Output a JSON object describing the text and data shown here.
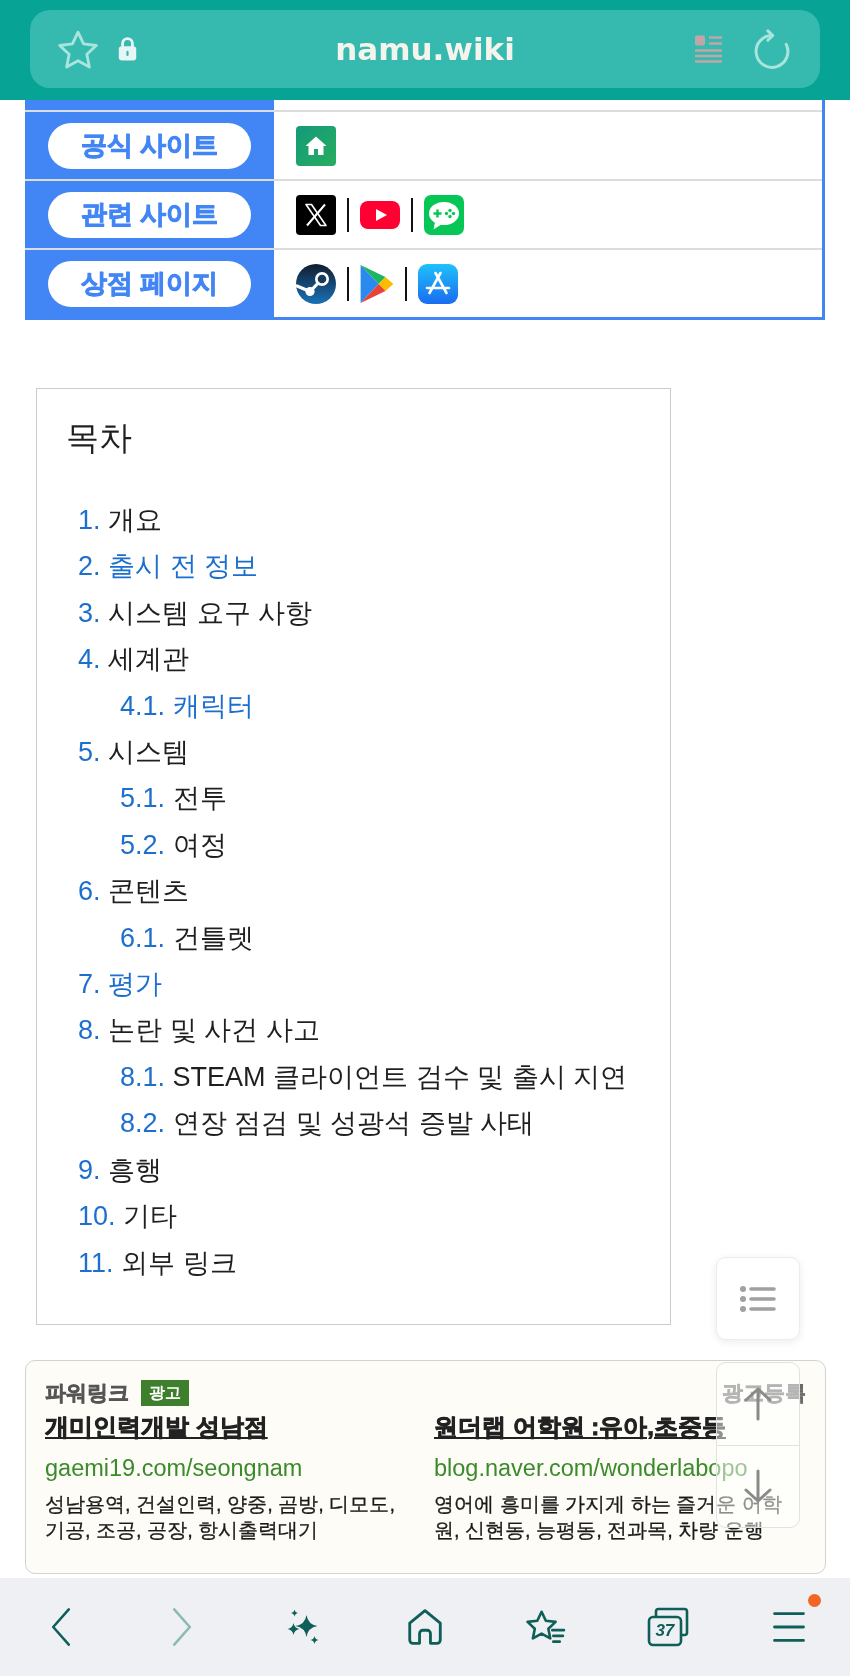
{
  "browser_bar": {
    "address": "namu.wiki"
  },
  "info_table": {
    "rows": [
      {
        "label": "공식 사이트",
        "links": [
          {
            "kind": "home"
          }
        ]
      },
      {
        "label": "관련 사이트",
        "links": [
          {
            "kind": "x"
          },
          {
            "kind": "video"
          },
          {
            "kind": "chat"
          }
        ]
      },
      {
        "label": "상점 페이지",
        "links": [
          {
            "kind": "steam"
          },
          {
            "kind": "play"
          },
          {
            "kind": "store"
          }
        ]
      }
    ]
  },
  "toc": {
    "title": "목차",
    "items": [
      {
        "number": "1.",
        "title": "개요",
        "linked": false
      },
      {
        "number": "2.",
        "title": "출시 전 정보",
        "linked": true
      },
      {
        "number": "3.",
        "title": "시스템 요구 사항",
        "linked": false
      },
      {
        "number": "4.",
        "title": "세계관",
        "linked": false,
        "children": [
          {
            "number": "4.1.",
            "title": "캐릭터",
            "linked": true
          }
        ]
      },
      {
        "number": "5.",
        "title": "시스템",
        "linked": false,
        "children": [
          {
            "number": "5.1.",
            "title": "전투",
            "linked": false
          },
          {
            "number": "5.2.",
            "title": "여정",
            "linked": false
          }
        ]
      },
      {
        "number": "6.",
        "title": "콘텐츠",
        "linked": false,
        "children": [
          {
            "number": "6.1.",
            "title": "건틀렛",
            "linked": false
          }
        ]
      },
      {
        "number": "7.",
        "title": "평가",
        "linked": true
      },
      {
        "number": "8.",
        "title": "논란 및 사건 사고",
        "linked": false,
        "children": [
          {
            "number": "8.1.",
            "title": "STEAM 클라이언트 검수 및 출시 지연",
            "linked": false
          },
          {
            "number": "8.2.",
            "title": "연장 점검 및 성광석 증발 사태",
            "linked": false
          }
        ]
      },
      {
        "number": "9.",
        "title": "흥행",
        "linked": false
      },
      {
        "number": "10.",
        "title": "기타",
        "linked": false
      },
      {
        "number": "11.",
        "title": "외부 링크",
        "linked": false
      }
    ]
  },
  "powerlink": {
    "title": "파워링크",
    "badge": "광고",
    "register_link": "광고등록",
    "ads": [
      {
        "title": "개미인력개발 성남점",
        "url": "gaemi19.com/seongnam",
        "description": "성남용역, 건설인력, 양중, 곰방, 디모도, 기공, 조공, 공장, 항시출력대기"
      },
      {
        "title": "원더랩 어학원 :유아,초중등",
        "url": "blog.naver.com/wonderlabopo",
        "description": "영어에 흥미를 가지게 하는 즐거운 어학원, 신현동, 능평동, 전과목, 차량 운행"
      }
    ]
  },
  "bottom_toolbar": {
    "items": [
      {
        "kind": "back",
        "disabled": false
      },
      {
        "kind": "forward",
        "disabled": true
      },
      {
        "kind": "sparkle",
        "disabled": false
      },
      {
        "kind": "home",
        "disabled": false
      },
      {
        "kind": "bookmarks",
        "disabled": false
      },
      {
        "kind": "tabs",
        "count": "37",
        "disabled": false
      },
      {
        "kind": "menu",
        "disabled": false,
        "notification": true
      }
    ]
  }
}
